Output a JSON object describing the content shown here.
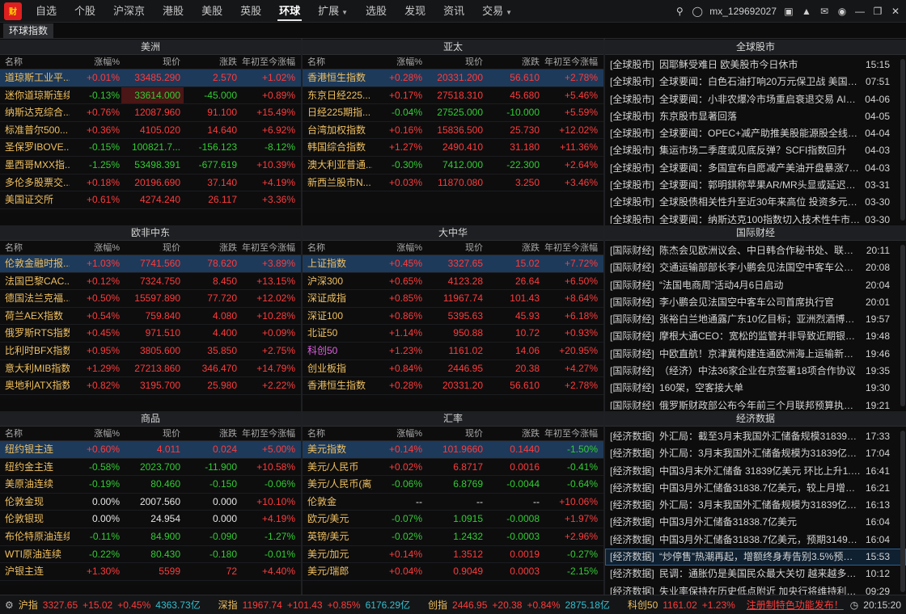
{
  "nav": {
    "items": [
      {
        "label": "自选",
        "active": false
      },
      {
        "label": "个股",
        "active": false
      },
      {
        "label": "沪深京",
        "active": false
      },
      {
        "label": "港股",
        "active": false
      },
      {
        "label": "美股",
        "active": false
      },
      {
        "label": "英股",
        "active": false
      },
      {
        "label": "环球",
        "active": true
      },
      {
        "label": "扩展",
        "active": false,
        "dropdown": true
      },
      {
        "label": "选股",
        "active": false
      },
      {
        "label": "发现",
        "active": false
      },
      {
        "label": "资讯",
        "active": false
      },
      {
        "label": "交易",
        "active": false,
        "dropdown": true
      }
    ],
    "logo_text": "财"
  },
  "user": {
    "name": "mx_129692027"
  },
  "tab": {
    "label": "环球指数"
  },
  "columns": {
    "name": "名称",
    "pct": "涨幅%",
    "price": "现价",
    "chg": "涨跌",
    "ytd": "年初至今涨幅"
  },
  "panels": {
    "americas": {
      "title": "美洲",
      "rows": [
        {
          "name": "道琼斯工业平...",
          "pct": "+0.01%",
          "price": "33485.290",
          "chg": "2.570",
          "ytd": "+1.02%",
          "sel": true
        },
        {
          "name": "迷你道琼斯连续",
          "pct": "-0.13%",
          "price": "33614.000",
          "chg": "-45.000",
          "ytd": "+0.89%",
          "hi": true
        },
        {
          "name": "纳斯达克综合...",
          "pct": "+0.76%",
          "price": "12087.960",
          "chg": "91.100",
          "ytd": "+15.49%"
        },
        {
          "name": "标准普尔500...",
          "pct": "+0.36%",
          "price": "4105.020",
          "chg": "14.640",
          "ytd": "+6.92%"
        },
        {
          "name": "圣保罗IBOVE...",
          "pct": "-0.15%",
          "price": "100821.7...",
          "chg": "-156.123",
          "ytd": "-8.12%"
        },
        {
          "name": "墨西哥MXX指...",
          "pct": "-1.25%",
          "price": "53498.391",
          "chg": "-677.619",
          "ytd": "+10.39%"
        },
        {
          "name": "多伦多股票交...",
          "pct": "+0.18%",
          "price": "20196.690",
          "chg": "37.140",
          "ytd": "+4.19%"
        },
        {
          "name": "美国证交所",
          "pct": "+0.61%",
          "price": "4274.240",
          "chg": "26.117",
          "ytd": "+3.36%"
        }
      ]
    },
    "asiapac": {
      "title": "亚太",
      "rows": [
        {
          "name": "香港恒生指数",
          "pct": "+0.28%",
          "price": "20331.200",
          "chg": "56.610",
          "ytd": "+2.78%",
          "sel": true
        },
        {
          "name": "东京日经225...",
          "pct": "+0.17%",
          "price": "27518.310",
          "chg": "45.680",
          "ytd": "+5.46%"
        },
        {
          "name": "日经225期指...",
          "pct": "-0.04%",
          "price": "27525.000",
          "chg": "-10.000",
          "ytd": "+5.59%"
        },
        {
          "name": "台湾加权指数",
          "pct": "+0.16%",
          "price": "15836.500",
          "chg": "25.730",
          "ytd": "+12.02%"
        },
        {
          "name": "韩国综合指数",
          "pct": "+1.27%",
          "price": "2490.410",
          "chg": "31.180",
          "ytd": "+11.36%"
        },
        {
          "name": "澳大利亚普通...",
          "pct": "-0.30%",
          "price": "7412.000",
          "chg": "-22.300",
          "ytd": "+2.64%"
        },
        {
          "name": "新西兰股市N...",
          "pct": "+0.03%",
          "price": "11870.080",
          "chg": "3.250",
          "ytd": "+3.46%"
        }
      ]
    },
    "emea": {
      "title": "欧非中东",
      "rows": [
        {
          "name": "伦敦金融时报...",
          "pct": "+1.03%",
          "price": "7741.560",
          "chg": "78.620",
          "ytd": "+3.89%",
          "sel": true
        },
        {
          "name": "法国巴黎CAC...",
          "pct": "+0.12%",
          "price": "7324.750",
          "chg": "8.450",
          "ytd": "+13.15%"
        },
        {
          "name": "德国法兰克福...",
          "pct": "+0.50%",
          "price": "15597.890",
          "chg": "77.720",
          "ytd": "+12.02%"
        },
        {
          "name": "荷兰AEX指数",
          "pct": "+0.54%",
          "price": "759.840",
          "chg": "4.080",
          "ytd": "+10.28%"
        },
        {
          "name": "俄罗斯RTS指数",
          "pct": "+0.45%",
          "price": "971.510",
          "chg": "4.400",
          "ytd": "+0.09%"
        },
        {
          "name": "比利时BFX指数",
          "pct": "+0.95%",
          "price": "3805.600",
          "chg": "35.850",
          "ytd": "+2.75%"
        },
        {
          "name": "意大利MIB指数",
          "pct": "+1.29%",
          "price": "27213.860",
          "chg": "346.470",
          "ytd": "+14.79%"
        },
        {
          "name": "奥地利ATX指数",
          "pct": "+0.82%",
          "price": "3195.700",
          "chg": "25.980",
          "ytd": "+2.22%"
        }
      ]
    },
    "greaterchina": {
      "title": "大中华",
      "rows": [
        {
          "name": "上证指数",
          "pct": "+0.45%",
          "price": "3327.65",
          "chg": "15.02",
          "ytd": "+7.72%",
          "sel": true
        },
        {
          "name": "沪深300",
          "pct": "+0.65%",
          "price": "4123.28",
          "chg": "26.64",
          "ytd": "+6.50%"
        },
        {
          "name": "深证成指",
          "pct": "+0.85%",
          "price": "11967.74",
          "chg": "101.43",
          "ytd": "+8.64%"
        },
        {
          "name": "深证100",
          "pct": "+0.86%",
          "price": "5395.63",
          "chg": "45.93",
          "ytd": "+6.18%"
        },
        {
          "name": "北证50",
          "pct": "+1.14%",
          "price": "950.88",
          "chg": "10.72",
          "ytd": "+0.93%"
        },
        {
          "name": "科创50",
          "pct": "+1.23%",
          "price": "1161.02",
          "chg": "14.06",
          "ytd": "+20.95%",
          "pink": true
        },
        {
          "name": "创业板指",
          "pct": "+0.84%",
          "price": "2446.95",
          "chg": "20.38",
          "ytd": "+4.27%"
        },
        {
          "name": "香港恒生指数",
          "pct": "+0.28%",
          "price": "20331.20",
          "chg": "56.610",
          "ytd": "+2.78%"
        }
      ]
    },
    "commodities": {
      "title": "商品",
      "rows": [
        {
          "name": "纽约银主连",
          "pct": "+0.60%",
          "price": "4.011",
          "chg": "0.024",
          "ytd": "+5.00%",
          "sel": true
        },
        {
          "name": "纽约金主连",
          "pct": "-0.58%",
          "price": "2023.700",
          "chg": "-11.900",
          "ytd": "+10.58%"
        },
        {
          "name": "美原油连续",
          "pct": "-0.19%",
          "price": "80.460",
          "chg": "-0.150",
          "ytd": "-0.06%"
        },
        {
          "name": "伦敦金现",
          "pct": "0.00%",
          "price": "2007.560",
          "chg": "0.000",
          "ytd": "+10.10%"
        },
        {
          "name": "伦敦银现",
          "pct": "0.00%",
          "price": "24.954",
          "chg": "0.000",
          "ytd": "+4.19%"
        },
        {
          "name": "布伦特原油连续",
          "pct": "-0.11%",
          "price": "84.900",
          "chg": "-0.090",
          "ytd": "-1.27%"
        },
        {
          "name": "WTI原油连续",
          "pct": "-0.22%",
          "price": "80.430",
          "chg": "-0.180",
          "ytd": "-0.01%"
        },
        {
          "name": "沪银主连",
          "pct": "+1.30%",
          "price": "5599",
          "chg": "72",
          "ytd": "+4.40%"
        }
      ]
    },
    "fx": {
      "title": "汇率",
      "rows": [
        {
          "name": "美元指数",
          "pct": "+0.14%",
          "price": "101.9660",
          "chg": "0.1440",
          "ytd": "-1.50%",
          "sel": true
        },
        {
          "name": "美元/人民币",
          "pct": "+0.02%",
          "price": "6.8717",
          "chg": "0.0016",
          "ytd": "-0.41%"
        },
        {
          "name": "美元/人民币(离)",
          "pct": "-0.06%",
          "price": "6.8769",
          "chg": "-0.0044",
          "ytd": "-0.64%"
        },
        {
          "name": "伦敦金",
          "pct": "--",
          "price": "--",
          "chg": "--",
          "ytd": "+10.06%"
        },
        {
          "name": "欧元/美元",
          "pct": "-0.07%",
          "price": "1.0915",
          "chg": "-0.0008",
          "ytd": "+1.97%"
        },
        {
          "name": "英镑/美元",
          "pct": "-0.02%",
          "price": "1.2432",
          "chg": "-0.0003",
          "ytd": "+2.96%"
        },
        {
          "name": "美元/加元",
          "pct": "+0.14%",
          "price": "1.3512",
          "chg": "0.0019",
          "ytd": "-0.27%"
        },
        {
          "name": "美元/瑞郎",
          "pct": "+0.04%",
          "price": "0.9049",
          "chg": "0.0003",
          "ytd": "-2.15%"
        }
      ]
    }
  },
  "news": {
    "global": {
      "title": "全球股市",
      "items": [
        {
          "tag": "[全球股市]",
          "text": "因耶稣受难日 欧美股市今日休市",
          "time": "15:15"
        },
        {
          "tag": "[全球股市]",
          "text": "全球要闻：白色石油打响20万元保卫战 美国将推...",
          "time": "07:51"
        },
        {
          "tag": "[全球股市]",
          "text": "全球要闻：小非农爆冷市场重启衰退交易 AI正遭...",
          "time": "04-06"
        },
        {
          "tag": "[全球股市]",
          "text": "东京股市显著回落",
          "time": "04-05"
        },
        {
          "tag": "[全球股市]",
          "text": "全球要闻：OPEC+减产助推美股能源股全线大涨...",
          "time": "04-04"
        },
        {
          "tag": "[全球股市]",
          "text": "集运市场二季度或见底反弹？SCFI指数回升",
          "time": "04-03"
        },
        {
          "tag": "[全球股市]",
          "text": "全球要闻：多国宣布自愿减产美油开盘暴涨7% 本...",
          "time": "04-03"
        },
        {
          "tag": "[全球股市]",
          "text": "全球要闻：郭明錤称苹果AR/MR头显或延迟发布...",
          "time": "03-31"
        },
        {
          "tag": "[全球股市]",
          "text": "全球股债相关性升至近30年来高位 投资多元化遭...",
          "time": "03-30"
        },
        {
          "tag": "[全球股市]",
          "text": "全球要闻：纳斯达克100指数切入技术性牛市 苹果...",
          "time": "03-30"
        }
      ]
    },
    "intl": {
      "title": "国际财经",
      "items": [
        {
          "tag": "[国际财经]",
          "text": "陈杰会见欧洲议会、中日韩合作秘书处、联合国环...",
          "time": "20:11"
        },
        {
          "tag": "[国际财经]",
          "text": "交通运输部部长李小鹏会见法国空中客车公司首席...",
          "time": "20:08"
        },
        {
          "tag": "[国际财经]",
          "text": "“法国电商周”活动4月6日启动",
          "time": "20:04"
        },
        {
          "tag": "[国际财经]",
          "text": "李小鹏会见法国空中客车公司首席执行官",
          "time": "20:01"
        },
        {
          "tag": "[国际财经]",
          "text": "张裕白兰地通露广东10亿目标；亚洲烈酒博势显著",
          "time": "19:57"
        },
        {
          "tag": "[国际财经]",
          "text": "摩根大通CEO：宽松的监管并非导致近期银行业倒...",
          "time": "19:48"
        },
        {
          "tag": "[国际财经]",
          "text": "中欧直航！京津冀构建连通欧洲海上运输新通道",
          "time": "19:46"
        },
        {
          "tag": "[国际财经]",
          "text": "（经济）中法36家企业在京签署18项合作协议",
          "time": "19:35"
        },
        {
          "tag": "[国际财经]",
          "text": "160架，空客接大单",
          "time": "19:30"
        },
        {
          "tag": "[国际财经]",
          "text": "俄罗斯财政部公布今年前三个月联邦预算执行的初...",
          "time": "19:21"
        }
      ]
    },
    "econ": {
      "title": "经济数据",
      "items": [
        {
          "tag": "[经济数据]",
          "text": "外汇局：截至3月末我国外汇储备规模31839亿美元",
          "time": "17:33"
        },
        {
          "tag": "[经济数据]",
          "text": "外汇局：3月末我国外汇储备规模为31839亿美元",
          "time": "17:04"
        },
        {
          "tag": "[经济数据]",
          "text": "中国3月末外汇储备 31839亿美元 环比上升1.62%",
          "time": "16:41"
        },
        {
          "tag": "[经济数据]",
          "text": "中国3月外汇储备31838.7亿美元，较上月增多500...",
          "time": "16:21"
        },
        {
          "tag": "[经济数据]",
          "text": "外汇局：3月末我国外汇储备规模为31839亿美元",
          "time": "16:13"
        },
        {
          "tag": "[经济数据]",
          "text": "中国3月外汇储备31838.7亿美元",
          "time": "16:04"
        },
        {
          "tag": "[经济数据]",
          "text": "中国3月外汇储备31838.7亿美元，预期31490亿美...",
          "time": "16:04"
        },
        {
          "tag": "[经济数据]",
          "text": "“炒停售”热潮再起，增额终身寿告别3.5%预定利...",
          "time": "15:53",
          "sel": true
        },
        {
          "tag": "[经济数据]",
          "text": "民调：通胀仍是美国民众最大关切 越来越多人担...",
          "time": "10:12"
        },
        {
          "tag": "[经济数据]",
          "text": "失业率保持在历史低点附近 加央行将维持利率不变",
          "time": "09:29"
        }
      ]
    }
  },
  "status": {
    "items": [
      {
        "label": "沪指",
        "value": "3327.65",
        "chg": "+15.02",
        "pct": "+0.45%",
        "amt": "4363.73亿"
      },
      {
        "label": "深指",
        "value": "11967.74",
        "chg": "+101.43",
        "pct": "+0.85%",
        "amt": "6176.29亿"
      },
      {
        "label": "创指",
        "value": "2446.95",
        "chg": "+20.38",
        "pct": "+0.84%",
        "amt": "2875.18亿"
      },
      {
        "label": "科创50",
        "value": "1161.02",
        "chg": "+1.23%",
        "pct": "",
        "amt": ""
      }
    ],
    "notice": "注册制特色功能发布！",
    "time": "20:15:20"
  },
  "colors": {
    "up": "#ff3b3b",
    "down": "#33cc33",
    "flat": "#e6e6e6",
    "name": "#f0c060",
    "selected_row": "#1d3a5b"
  },
  "icons": [
    "search-icon",
    "user-icon",
    "message-icon",
    "shirt-icon",
    "mail-icon",
    "bell-icon",
    "minimize-icon",
    "restore-icon",
    "close-icon",
    "settings-icon"
  ]
}
